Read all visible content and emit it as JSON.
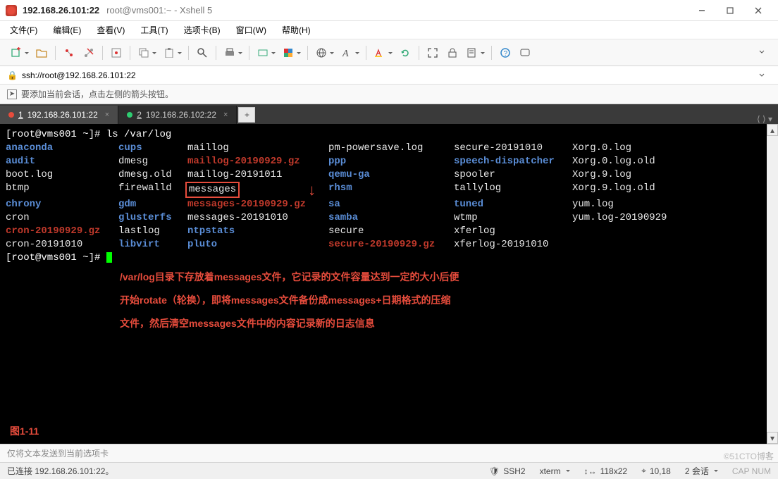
{
  "window": {
    "address": "192.168.26.101:22",
    "title_suffix": "root@vms001:~ - Xshell 5"
  },
  "menu": {
    "file": "文件(F)",
    "edit": "编辑(E)",
    "view": "查看(V)",
    "tools": "工具(T)",
    "tabs": "选项卡(B)",
    "window": "窗口(W)",
    "help": "帮助(H)"
  },
  "addressbar": {
    "url": "ssh://root@192.168.26.101:22"
  },
  "hintbar": {
    "text": "要添加当前会话，点击左侧的箭头按钮。"
  },
  "tabs": {
    "active": {
      "num": "1",
      "label": "192.168.26.101:22"
    },
    "second": {
      "num": "2",
      "label": "192.168.26.102:22"
    }
  },
  "terminal": {
    "prompt": "[root@vms001 ~]#",
    "command": "ls /var/log",
    "ls": {
      "rows": [
        {
          "c1": {
            "t": "anaconda",
            "cls": "dir"
          },
          "c2": {
            "t": "cups",
            "cls": "dir"
          },
          "c3": {
            "t": "maillog",
            "cls": "norm"
          },
          "c4": {
            "t": "pm-powersave.log",
            "cls": "norm"
          },
          "c5": {
            "t": "secure-20191010",
            "cls": "norm"
          },
          "c6": {
            "t": "Xorg.0.log",
            "cls": "norm"
          }
        },
        {
          "c1": {
            "t": "audit",
            "cls": "dir"
          },
          "c2": {
            "t": "dmesg",
            "cls": "norm"
          },
          "c3": {
            "t": "maillog-20190929.gz",
            "cls": "gz"
          },
          "c4": {
            "t": "ppp",
            "cls": "dir"
          },
          "c5": {
            "t": "speech-dispatcher",
            "cls": "dir"
          },
          "c6": {
            "t": "Xorg.0.log.old",
            "cls": "norm"
          }
        },
        {
          "c1": {
            "t": "boot.log",
            "cls": "norm"
          },
          "c2": {
            "t": "dmesg.old",
            "cls": "norm"
          },
          "c3": {
            "t": "maillog-20191011",
            "cls": "norm"
          },
          "c4": {
            "t": "qemu-ga",
            "cls": "dir"
          },
          "c5": {
            "t": "spooler",
            "cls": "norm"
          },
          "c6": {
            "t": "Xorg.9.log",
            "cls": "norm"
          }
        },
        {
          "c1": {
            "t": "btmp",
            "cls": "norm"
          },
          "c2": {
            "t": "firewalld",
            "cls": "norm"
          },
          "c3": {
            "t": "messages",
            "cls": "norm",
            "box": true
          },
          "c4": {
            "t": "rhsm",
            "cls": "dir"
          },
          "c5": {
            "t": "tallylog",
            "cls": "norm"
          },
          "c6": {
            "t": "Xorg.9.log.old",
            "cls": "norm"
          }
        },
        {
          "c1": {
            "t": "chrony",
            "cls": "dir"
          },
          "c2": {
            "t": "gdm",
            "cls": "dir"
          },
          "c3": {
            "t": "messages-20190929.gz",
            "cls": "red-underline"
          },
          "c4": {
            "t": "sa",
            "cls": "dir"
          },
          "c5": {
            "t": "tuned",
            "cls": "dir"
          },
          "c6": {
            "t": "yum.log",
            "cls": "norm"
          }
        },
        {
          "c1": {
            "t": "cron",
            "cls": "norm"
          },
          "c2": {
            "t": "glusterfs",
            "cls": "dir"
          },
          "c3": {
            "t": "messages-20191010",
            "cls": "norm"
          },
          "c4": {
            "t": "samba",
            "cls": "dir"
          },
          "c5": {
            "t": "wtmp",
            "cls": "norm"
          },
          "c6": {
            "t": "yum.log-20190929",
            "cls": "norm"
          }
        },
        {
          "c1": {
            "t": "cron-20190929.gz",
            "cls": "gz"
          },
          "c2": {
            "t": "lastlog",
            "cls": "norm"
          },
          "c3": {
            "t": "ntpstats",
            "cls": "dir"
          },
          "c4": {
            "t": "secure",
            "cls": "norm"
          },
          "c5": {
            "t": "xferlog",
            "cls": "norm"
          },
          "c6": {
            "t": "",
            "cls": "norm"
          }
        },
        {
          "c1": {
            "t": "cron-20191010",
            "cls": "norm"
          },
          "c2": {
            "t": "libvirt",
            "cls": "dir"
          },
          "c3": {
            "t": "pluto",
            "cls": "dir"
          },
          "c4": {
            "t": "secure-20190929.gz",
            "cls": "gz"
          },
          "c5": {
            "t": "xferlog-20191010",
            "cls": "norm"
          },
          "c6": {
            "t": "",
            "cls": "norm"
          }
        }
      ]
    },
    "annotation": {
      "l1": "/var/log目录下存放着messages文件，它记录的文件容量达到一定的大小后便",
      "l2": "开始rotate（轮换），即将messages文件备份成messages+日期格式的压缩",
      "l3": "文件，然后清空messages文件中的内容记录新的日志信息"
    },
    "figure_label": "图1-11"
  },
  "bottom_input": {
    "placeholder": "仅将文本发送到当前选项卡"
  },
  "statusbar": {
    "connected": "已连接 192.168.26.101:22。",
    "protocol": "SSH2",
    "term": "xterm",
    "size": "118x22",
    "cursor": "10,18",
    "sessions_label": "2 会话"
  },
  "icons": {
    "lock": "🔒",
    "arrow": "➤",
    "double_arrow": "↕"
  },
  "watermark": "©51CTO博客"
}
